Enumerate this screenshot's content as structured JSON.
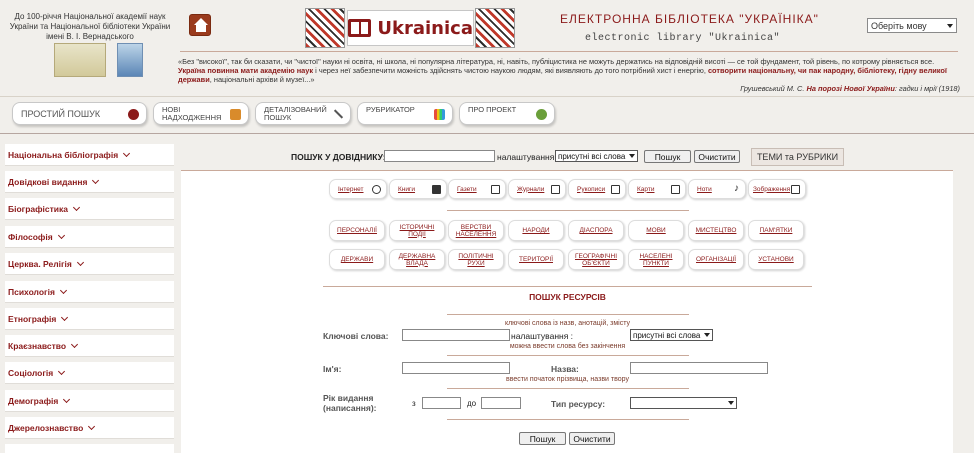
{
  "header": {
    "anniversary_text": "До 100-річчя Національної академії наук України та Національної бібліотеки України імені В. І. Вернадського",
    "logo_text": "Ukrainica",
    "title": "ЕЛЕКТРОННА БІБЛІОТЕКА \"УКРАЇНІКА\"",
    "subtitle": "electronic library \"Ukrainica\"",
    "language_select": "Оберіть мову",
    "quote_part1": "«Без \"високої\", так би сказати, чи \"чистої\" науки ні освіта, ні школа, ні популярна література, ні, навіть, публіцистика не можуть держатись на відповідній висоті — се той фундамент, той рівень, по котрому рівняється все.",
    "quote_bold1": "Україна повинна мати академію наук",
    "quote_part2": "і через неї забезпечити можність здійснять чистою наукою людям, які виявляють до того потрібний хист і енергію,",
    "quote_bold2": "сотворити національну, чи пак народну, бібліотеку, гідну великої держави",
    "quote_part3": ", національні архіви й музеї...»",
    "quote_author": "Грушевський М. С.",
    "quote_work": "На порозі Нової України",
    "quote_tail": ": гадки і мрії (1918)"
  },
  "nav": {
    "simple_search": "ПРОСТИЙ ПОШУК",
    "new_arrivals": "НОВІ НАДХОДЖЕННЯ",
    "advanced_search": "ДЕТАЛІЗОВАНИЙ ПОШУК",
    "rubricator": "РУБРИКАТОР",
    "about": "ПРО ПРОЕКТ"
  },
  "sidebar": {
    "items": [
      "Національна бібліографія",
      "Довідкові видання",
      "Біографістика",
      "Філософія",
      "Церква. Релігія",
      "Психологія",
      "Етнографія",
      "Краєзнавство",
      "Соціологія",
      "Демографія",
      "Джерелознавство"
    ]
  },
  "directory_search": {
    "label": "ПОШУК У ДОВІДНИКУ:",
    "settings_label": "налаштування:",
    "settings_value": "присутні всі слова",
    "search_button": "Пошук",
    "clear_button": "Очистити",
    "themes_button": "ТЕМИ та РУБРИКИ"
  },
  "media_types": [
    {
      "label": "Інтернет",
      "icon": "globe-icon"
    },
    {
      "label": "Книги",
      "icon": "book-icon"
    },
    {
      "label": "Газети",
      "icon": "newspaper-icon"
    },
    {
      "label": "Журнали",
      "icon": "magazine-icon"
    },
    {
      "label": "Рукописи",
      "icon": "pen-icon"
    },
    {
      "label": "Карти",
      "icon": "map-icon"
    },
    {
      "label": "Ноти",
      "icon": "music-note-icon"
    },
    {
      "label": "Зображення",
      "icon": "image-icon"
    }
  ],
  "categories_row1": [
    "ПЕРСОНАЛІЇ",
    "ІСТОРИЧНІ ПОДІЇ",
    "ВЕРСТВИ НАСЕЛЕННЯ",
    "НАРОДИ",
    "ДІАСПОРА",
    "МОВИ",
    "МИСТЕЦТВО",
    "ПАМ'ЯТКИ"
  ],
  "categories_row2": [
    "ДЕРЖАВИ",
    "ДЕРЖАВНА ВЛАДА",
    "ПОЛІТИЧНІ РУХИ",
    "ТЕРИТОРІЇ",
    "ГЕОГРАФІЧНІ ОБ'ЄКТИ",
    "НАСЕЛЕНІ ПУНКТИ",
    "ОРГАНІЗАЦІЇ",
    "УСТАНОВИ"
  ],
  "resource_search": {
    "title": "ПОШУК РЕСУРСІВ",
    "keywords_hint_top": "ключові слова із назв, анотацій, змісту",
    "keywords_label": "Ключові слова:",
    "keywords_settings_label": "налаштування :",
    "keywords_settings_value": "присутні всі слова",
    "keywords_hint_bottom": "можна ввести слова без закінчення",
    "name_label": "Ім'я:",
    "title_label": "Назва:",
    "name_hint": "ввести початок прізвища, назви твору",
    "year_label": "Рік видання (написання):",
    "year_from": "з",
    "year_to": "до",
    "resource_type_label": "Тип ресурсу:",
    "search_button": "Пошук",
    "clear_button": "Очистити"
  }
}
